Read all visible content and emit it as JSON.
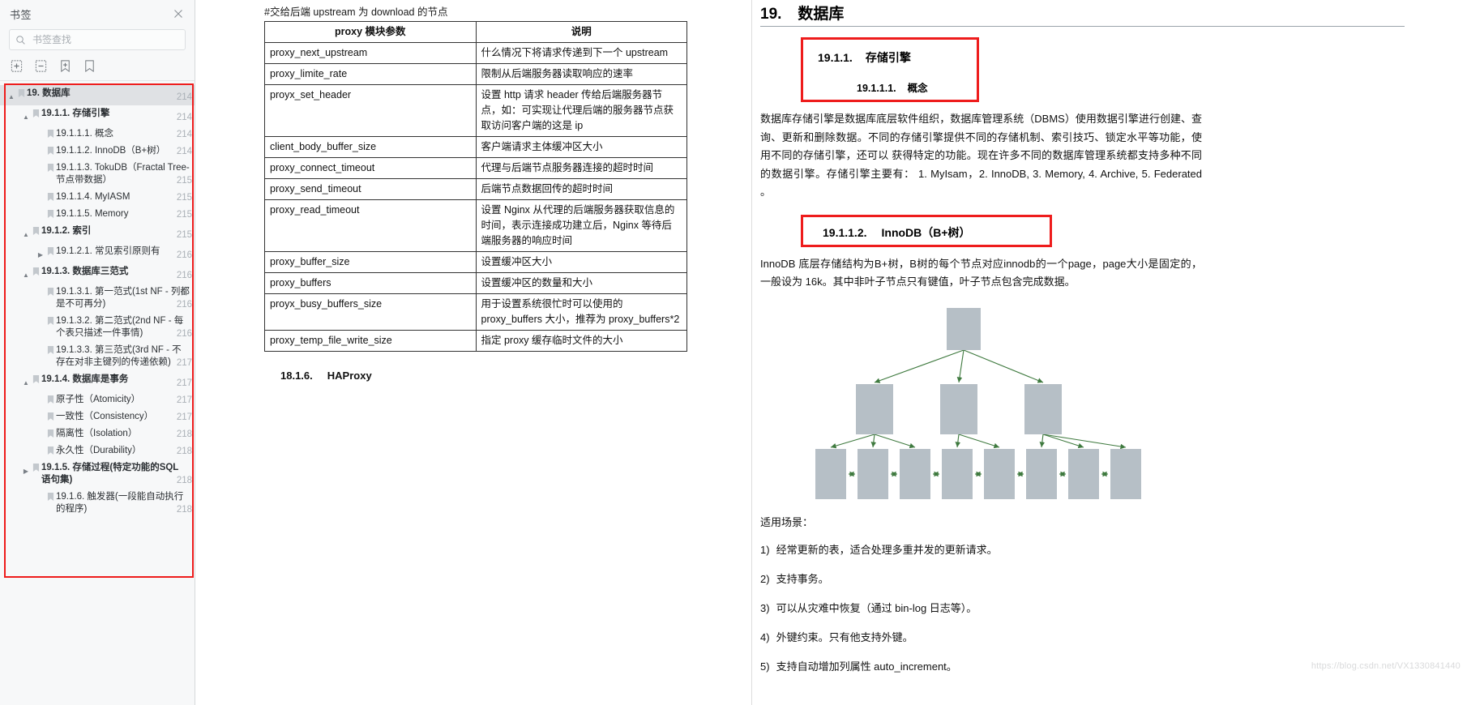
{
  "sidebar": {
    "title": "书签",
    "close_icon": "close-icon",
    "search": {
      "placeholder": "书签查找",
      "value": "",
      "icon": "search-icon"
    },
    "tools": [
      {
        "name": "expand-all-icon",
        "label": "展开全部"
      },
      {
        "name": "collapse-all-icon",
        "label": "折叠全部"
      },
      {
        "name": "add-bookmark-icon",
        "label": "添加书签"
      },
      {
        "name": "bookmark-icon",
        "label": "书签"
      }
    ],
    "tree": [
      {
        "label": "19. 数据库",
        "page": "214",
        "level": 0,
        "twist": "▲",
        "selected": true,
        "bold": true
      },
      {
        "label": "19.1.1. 存储引擎",
        "page": "214",
        "level": 1,
        "twist": "▲",
        "bold": true
      },
      {
        "label": "19.1.1.1. 概念",
        "page": "214",
        "level": 2,
        "twist": ""
      },
      {
        "label": "19.1.1.2. InnoDB（B+树）",
        "page": "214",
        "level": 2,
        "twist": ""
      },
      {
        "label": "19.1.1.3. TokuDB（Fractal Tree-节点带数据）",
        "page": "215",
        "level": 2,
        "twist": ""
      },
      {
        "label": "19.1.1.4. MyIASM",
        "page": "215",
        "level": 2,
        "twist": ""
      },
      {
        "label": "19.1.1.5. Memory",
        "page": "215",
        "level": 2,
        "twist": ""
      },
      {
        "label": "19.1.2. 索引",
        "page": "215",
        "level": 1,
        "twist": "▲",
        "bold": true
      },
      {
        "label": "19.1.2.1. 常见索引原则有",
        "page": "216",
        "level": 2,
        "twist": "▶"
      },
      {
        "label": "19.1.3. 数据库三范式",
        "page": "216",
        "level": 1,
        "twist": "▲",
        "bold": true
      },
      {
        "label": "19.1.3.1. 第一范式(1st NF - 列都是不可再分)",
        "page": "216",
        "level": 2,
        "twist": ""
      },
      {
        "label": "19.1.3.2. 第二范式(2nd NF - 每个表只描述一件事情)",
        "page": "216",
        "level": 2,
        "twist": ""
      },
      {
        "label": "19.1.3.3. 第三范式(3rd NF - 不存在对非主键列的传递依赖)",
        "page": "217",
        "level": 2,
        "twist": ""
      },
      {
        "label": "19.1.4. 数据库是事务",
        "page": "217",
        "level": 1,
        "twist": "▲",
        "bold": true
      },
      {
        "label": "原子性（Atomicity）",
        "page": "217",
        "level": 2,
        "twist": ""
      },
      {
        "label": "一致性（Consistency）",
        "page": "217",
        "level": 2,
        "twist": ""
      },
      {
        "label": "隔离性（Isolation）",
        "page": "218",
        "level": 2,
        "twist": ""
      },
      {
        "label": "永久性（Durability）",
        "page": "218",
        "level": 2,
        "twist": ""
      },
      {
        "label": "19.1.5. 存储过程(特定功能的SQL 语句集)",
        "page": "218",
        "level": 1,
        "twist": "▶",
        "bold": true
      },
      {
        "label": "19.1.6. 触发器(一段能自动执行的程序)",
        "page": "218",
        "level": 2,
        "twist": ""
      }
    ]
  },
  "middle": {
    "code_line": "#交给后端 upstream 为 download 的节点",
    "table": {
      "headers": [
        "proxy 模块参数",
        "说明"
      ],
      "rows": [
        [
          "proxy_next_upstream",
          "什么情况下将请求传递到下一个 upstream"
        ],
        [
          "proxy_limite_rate",
          "限制从后端服务器读取响应的速率"
        ],
        [
          "proyx_set_header",
          "设置 http 请求 header 传给后端服务器节点，如：可实现让代理后端的服务器节点获取访问客户端的这是 ip"
        ],
        [
          "client_body_buffer_size",
          "客户端请求主体缓冲区大小"
        ],
        [
          "proxy_connect_timeout",
          "代理与后端节点服务器连接的超时时间"
        ],
        [
          "proxy_send_timeout",
          "后端节点数据回传的超时时间"
        ],
        [
          "proxy_read_timeout",
          "设置 Nginx 从代理的后端服务器获取信息的时间，表示连接成功建立后，Nginx 等待后端服务器的响应时间"
        ],
        [
          "proxy_buffer_size",
          "设置缓冲区大小"
        ],
        [
          "proxy_buffers",
          "设置缓冲区的数量和大小"
        ],
        [
          "proyx_busy_buffers_size",
          "用于设置系统很忙时可以使用的 proxy_buffers 大小，推荐为 proxy_buffers*2"
        ],
        [
          "proxy_temp_file_write_size",
          "指定 proxy 缓存临时文件的大小"
        ]
      ]
    },
    "section": {
      "number": "18.1.6.",
      "title": "HAProxy"
    }
  },
  "right": {
    "h1": {
      "number": "19.",
      "title": "数据库"
    },
    "box1": {
      "h2_number": "19.1.1.",
      "h2_title": "存储引擎",
      "h3_number": "19.1.1.1.",
      "h3_title": "概念"
    },
    "para1": "数据库存储引擎是数据库底层软件组织，数据库管理系统（DBMS）使用数据引擎进行创建、查询、更新和删除数据。不同的存储引擎提供不同的存储机制、索引技巧、锁定水平等功能，使用不同的存储引擎，还可以 获得特定的功能。现在许多不同的数据库管理系统都支持多种不同的数据引擎。存储引擎主要有： 1. MyIsam，2. InnoDB, 3. Memory, 4. Archive, 5. Federated 。",
    "box2": {
      "number": "19.1.1.2.",
      "title": "InnoDB（B+树）"
    },
    "para2": "InnoDB 底层存储结构为B+树，B树的每个节点对应innodb的一个page，page大小是固定的，一般设为 16k。其中非叶子节点只有键值，叶子节点包含完成数据。",
    "diagram": {
      "name": "b-plus-tree-diagram",
      "node_fill": "#b6bfc6",
      "arrow_color": "#3f7a3f"
    },
    "listhead": "适用场景：",
    "list": [
      {
        "n": "1)",
        "text": "经常更新的表，适合处理多重并发的更新请求。"
      },
      {
        "n": "2)",
        "text": "支持事务。"
      },
      {
        "n": "3)",
        "text": "可以从灾难中恢复（通过 bin-log 日志等）。"
      },
      {
        "n": "4)",
        "text": "外键约束。只有他支持外键。"
      },
      {
        "n": "5)",
        "text": "支持自动增加列属性 auto_increment。"
      }
    ],
    "watermark": "https://blog.csdn.net/VX1330841440"
  },
  "colors": {
    "highlight_red": "#ee1c1c",
    "selection": "#dfe1e4",
    "node_fill": "#b6bfc6",
    "arrow": "#3f7a3f"
  }
}
